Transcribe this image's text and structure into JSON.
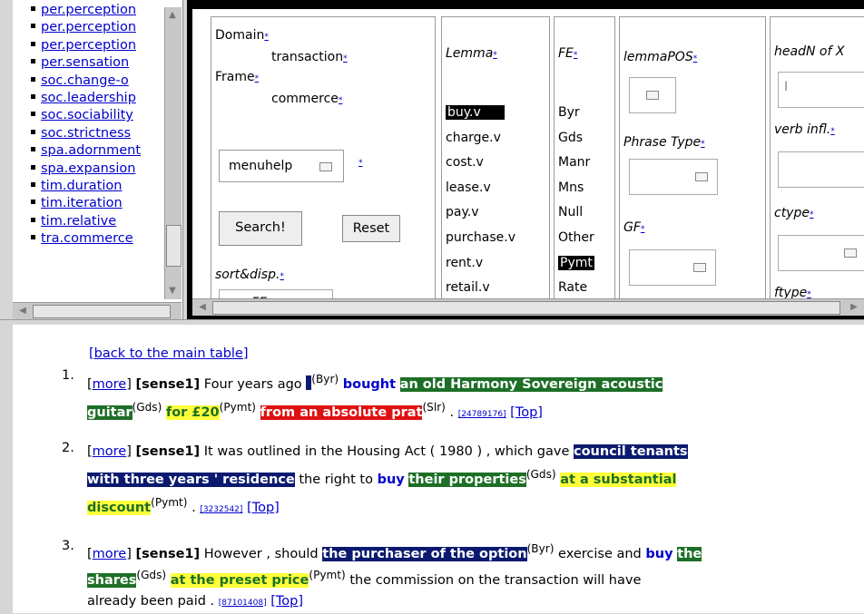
{
  "left_nav": {
    "items": [
      "per.perception",
      "per.perception",
      "per.perception",
      "per.sensation",
      "soc.change-o",
      "soc.leadership",
      "soc.sociability",
      "soc.strictness",
      "spa.adornment",
      "spa.expansion",
      "tim.duration",
      "tim.iteration",
      "tim.relative",
      "tra.commerce"
    ]
  },
  "search": {
    "domain_label": "Domain",
    "domain_value": "transaction",
    "frame_label": "Frame",
    "frame_value": "commerce",
    "help_dropdown": "menuhelp",
    "asterisk": "*",
    "search_button": "Search!",
    "reset_button": "Reset",
    "sort_label": "sort&disp.",
    "sort_value": "FE",
    "lemma_header": "Lemma",
    "lemmas": [
      "buy.v",
      "charge.v",
      "cost.v",
      "lease.v",
      "pay.v",
      "purchase.v",
      "rent.v",
      "retail.v"
    ],
    "lemma_selected": "buy.v",
    "fe_header": "FE",
    "fes": [
      "Byr",
      "Gds",
      "Manr",
      "Mns",
      "Null",
      "Other",
      "Pymt",
      "Rate"
    ],
    "fe_selected": "Pymt",
    "lemmapos_header": "lemmaPOS",
    "phrase_type_header": "Phrase Type",
    "gf_header": "GF",
    "headn_header": "headN of X",
    "verb_infl_header": "verb infl.",
    "ctype_header": "ctype",
    "ftype_header": "ftype"
  },
  "results": {
    "back_link": "[back to the main table]",
    "more_link": "more",
    "sense_label": "sense1",
    "top_link": "[Top]",
    "sentences": [
      {
        "num": "1.",
        "text_a": "Four years ago",
        "tag_byr": "(Byr)",
        "target": "bought",
        "gds_1": "an old Harmony Sovereign acoustic",
        "gds_2": "guitar",
        "tag_gds": "(Gds)",
        "pymt": "for £20",
        "tag_pymt": "(Pymt)",
        "slr": "from an absolute prat",
        "tag_slr": "(Slr)",
        "period": ".",
        "id": "[24789176]"
      },
      {
        "num": "2.",
        "text_a": "It was outlined in the Housing Act ( 1980 ) , which gave",
        "byr_1": "council tenants",
        "byr_2": "with three years ' residence",
        "text_b": "the right to",
        "target": "buy",
        "gds": "their properties",
        "tag_gds": "(Gds)",
        "pymt_1": "at a substantial",
        "pymt_2": "discount",
        "tag_pymt": "(Pymt)",
        "period": ".",
        "id": "[3232542]"
      },
      {
        "num": "3.",
        "text_a": "However , should",
        "byr": "the purchaser of the option",
        "tag_byr": "(Byr)",
        "text_b": "exercise and",
        "target": "buy",
        "gds_1": "the",
        "gds_2": "shares",
        "tag_gds": "(Gds)",
        "pymt": "at the preset price",
        "tag_pymt": "(Pymt)",
        "text_c": "the commission on the transaction will have",
        "text_d": "already been paid",
        "period": ".",
        "id": "[87101408]"
      }
    ]
  }
}
